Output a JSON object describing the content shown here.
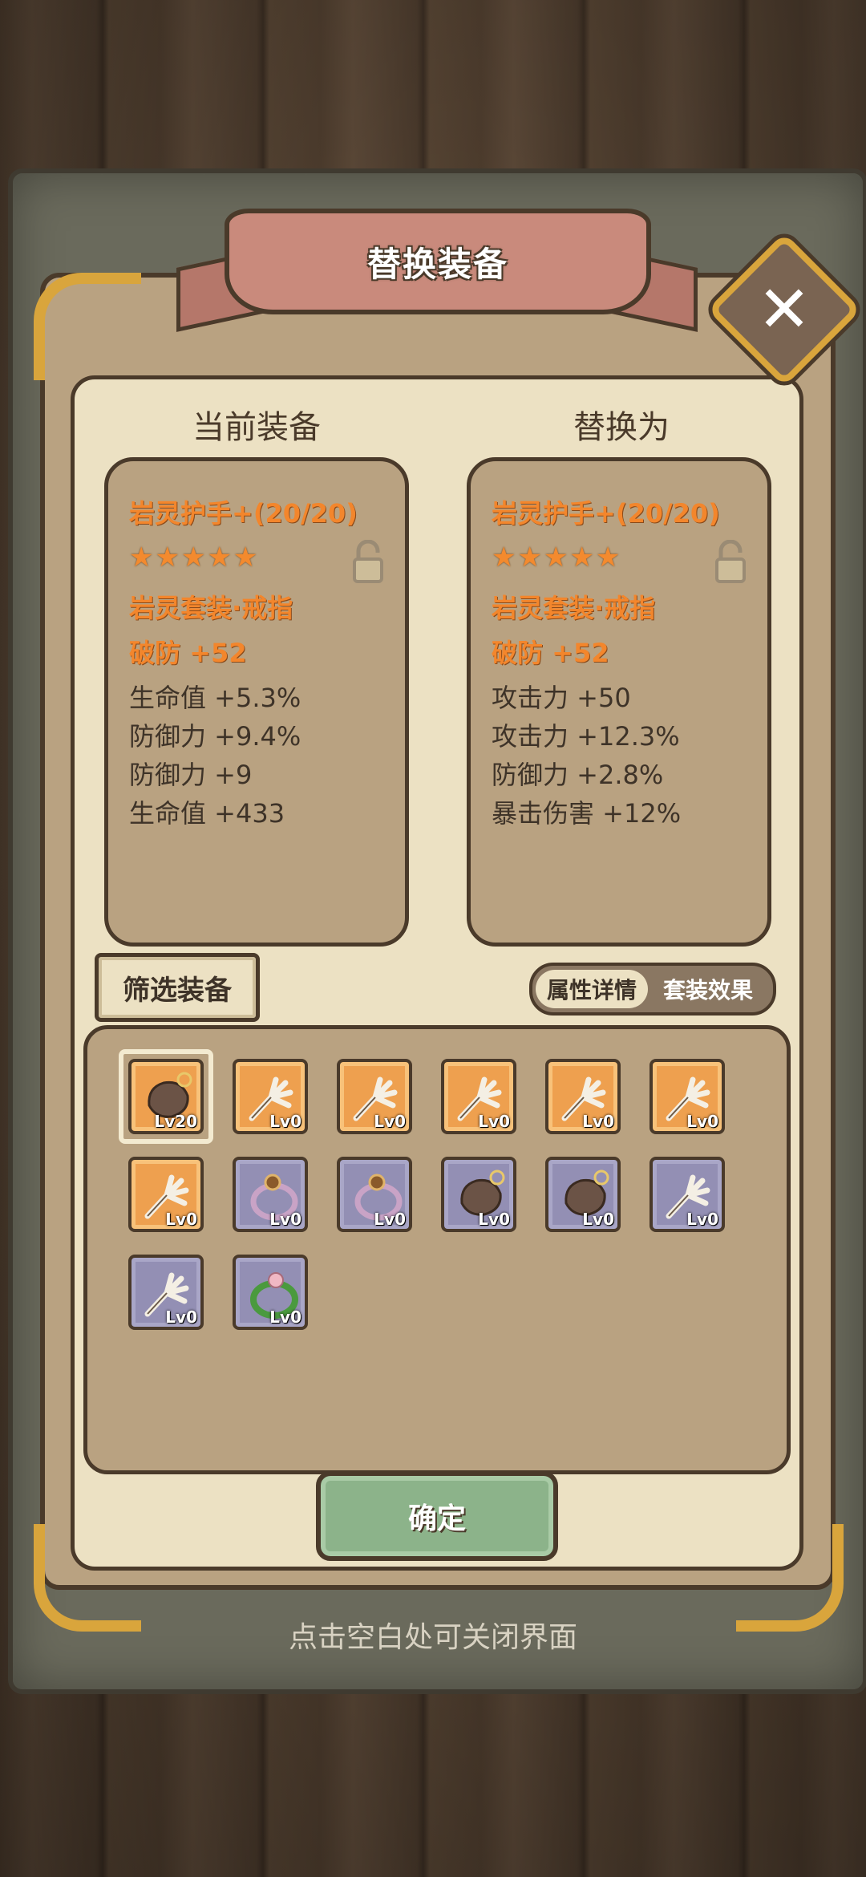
{
  "title": "替换装备",
  "close_icon": "close-icon",
  "columns": {
    "current": "当前装备",
    "replace": "替换为"
  },
  "current_item": {
    "name": "岩灵护手+(20/20)",
    "stars": "★★★★★",
    "set": "岩灵套装·戒指",
    "main_stat": "破防 +52",
    "sub_stats": [
      "生命值 +5.3%",
      "防御力 +9.4%",
      "防御力 +9",
      "生命值 +433"
    ]
  },
  "replace_item": {
    "name": "岩灵护手+(20/20)",
    "stars": "★★★★★",
    "set": "岩灵套装·戒指",
    "main_stat": "破防 +52",
    "sub_stats": [
      "攻击力 +50",
      "攻击力 +12.3%",
      "防御力 +2.8%",
      "暴击伤害 +12%"
    ]
  },
  "filter_label": "筛选装备",
  "toggle": {
    "attr": "属性详情",
    "set": "套装效果"
  },
  "inventory": [
    {
      "icon": "gauntlet-icon",
      "rarity": "orange",
      "level": "Lv20",
      "selected": true
    },
    {
      "icon": "claw-icon",
      "rarity": "orange",
      "level": "Lv0"
    },
    {
      "icon": "claw-icon",
      "rarity": "orange",
      "level": "Lv0"
    },
    {
      "icon": "claw-icon",
      "rarity": "orange",
      "level": "Lv0"
    },
    {
      "icon": "claw-icon",
      "rarity": "orange",
      "level": "Lv0"
    },
    {
      "icon": "claw-icon",
      "rarity": "orange",
      "level": "Lv0"
    },
    {
      "icon": "claw-icon",
      "rarity": "orange",
      "level": "Lv0"
    },
    {
      "icon": "ring-icon",
      "rarity": "purple",
      "level": "Lv0"
    },
    {
      "icon": "ring-icon",
      "rarity": "purple",
      "level": "Lv0"
    },
    {
      "icon": "gauntlet-icon",
      "rarity": "purple",
      "level": "Lv0"
    },
    {
      "icon": "gauntlet-icon",
      "rarity": "purple",
      "level": "Lv0"
    },
    {
      "icon": "claw-icon",
      "rarity": "purple",
      "level": "Lv0"
    },
    {
      "icon": "claw-icon",
      "rarity": "purple",
      "level": "Lv0"
    },
    {
      "icon": "vine-ring-icon",
      "rarity": "purple",
      "level": "Lv0"
    }
  ],
  "confirm_label": "确定",
  "hint": "点击空白处可关闭界面",
  "colors": {
    "highlight": "#f3862c",
    "panel": "#b9a281",
    "confirm": "#8cb38a"
  }
}
